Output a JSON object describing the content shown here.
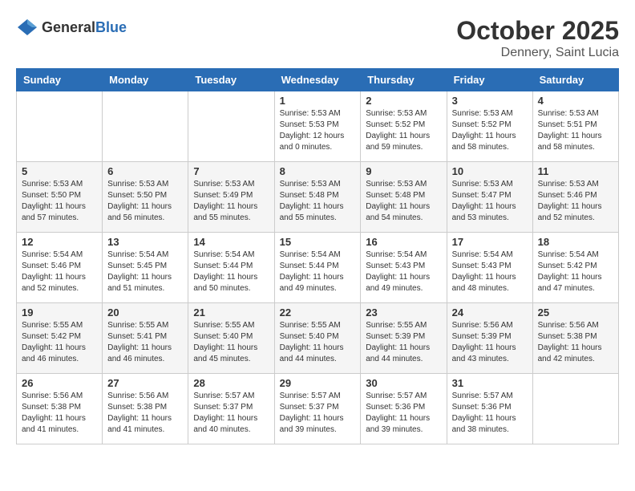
{
  "header": {
    "logo_general": "General",
    "logo_blue": "Blue",
    "month": "October 2025",
    "location": "Dennery, Saint Lucia"
  },
  "weekdays": [
    "Sunday",
    "Monday",
    "Tuesday",
    "Wednesday",
    "Thursday",
    "Friday",
    "Saturday"
  ],
  "weeks": [
    [
      {
        "day": "",
        "info": ""
      },
      {
        "day": "",
        "info": ""
      },
      {
        "day": "",
        "info": ""
      },
      {
        "day": "1",
        "info": "Sunrise: 5:53 AM\nSunset: 5:53 PM\nDaylight: 12 hours\nand 0 minutes."
      },
      {
        "day": "2",
        "info": "Sunrise: 5:53 AM\nSunset: 5:52 PM\nDaylight: 11 hours\nand 59 minutes."
      },
      {
        "day": "3",
        "info": "Sunrise: 5:53 AM\nSunset: 5:52 PM\nDaylight: 11 hours\nand 58 minutes."
      },
      {
        "day": "4",
        "info": "Sunrise: 5:53 AM\nSunset: 5:51 PM\nDaylight: 11 hours\nand 58 minutes."
      }
    ],
    [
      {
        "day": "5",
        "info": "Sunrise: 5:53 AM\nSunset: 5:50 PM\nDaylight: 11 hours\nand 57 minutes."
      },
      {
        "day": "6",
        "info": "Sunrise: 5:53 AM\nSunset: 5:50 PM\nDaylight: 11 hours\nand 56 minutes."
      },
      {
        "day": "7",
        "info": "Sunrise: 5:53 AM\nSunset: 5:49 PM\nDaylight: 11 hours\nand 55 minutes."
      },
      {
        "day": "8",
        "info": "Sunrise: 5:53 AM\nSunset: 5:48 PM\nDaylight: 11 hours\nand 55 minutes."
      },
      {
        "day": "9",
        "info": "Sunrise: 5:53 AM\nSunset: 5:48 PM\nDaylight: 11 hours\nand 54 minutes."
      },
      {
        "day": "10",
        "info": "Sunrise: 5:53 AM\nSunset: 5:47 PM\nDaylight: 11 hours\nand 53 minutes."
      },
      {
        "day": "11",
        "info": "Sunrise: 5:53 AM\nSunset: 5:46 PM\nDaylight: 11 hours\nand 52 minutes."
      }
    ],
    [
      {
        "day": "12",
        "info": "Sunrise: 5:54 AM\nSunset: 5:46 PM\nDaylight: 11 hours\nand 52 minutes."
      },
      {
        "day": "13",
        "info": "Sunrise: 5:54 AM\nSunset: 5:45 PM\nDaylight: 11 hours\nand 51 minutes."
      },
      {
        "day": "14",
        "info": "Sunrise: 5:54 AM\nSunset: 5:44 PM\nDaylight: 11 hours\nand 50 minutes."
      },
      {
        "day": "15",
        "info": "Sunrise: 5:54 AM\nSunset: 5:44 PM\nDaylight: 11 hours\nand 49 minutes."
      },
      {
        "day": "16",
        "info": "Sunrise: 5:54 AM\nSunset: 5:43 PM\nDaylight: 11 hours\nand 49 minutes."
      },
      {
        "day": "17",
        "info": "Sunrise: 5:54 AM\nSunset: 5:43 PM\nDaylight: 11 hours\nand 48 minutes."
      },
      {
        "day": "18",
        "info": "Sunrise: 5:54 AM\nSunset: 5:42 PM\nDaylight: 11 hours\nand 47 minutes."
      }
    ],
    [
      {
        "day": "19",
        "info": "Sunrise: 5:55 AM\nSunset: 5:42 PM\nDaylight: 11 hours\nand 46 minutes."
      },
      {
        "day": "20",
        "info": "Sunrise: 5:55 AM\nSunset: 5:41 PM\nDaylight: 11 hours\nand 46 minutes."
      },
      {
        "day": "21",
        "info": "Sunrise: 5:55 AM\nSunset: 5:40 PM\nDaylight: 11 hours\nand 45 minutes."
      },
      {
        "day": "22",
        "info": "Sunrise: 5:55 AM\nSunset: 5:40 PM\nDaylight: 11 hours\nand 44 minutes."
      },
      {
        "day": "23",
        "info": "Sunrise: 5:55 AM\nSunset: 5:39 PM\nDaylight: 11 hours\nand 44 minutes."
      },
      {
        "day": "24",
        "info": "Sunrise: 5:56 AM\nSunset: 5:39 PM\nDaylight: 11 hours\nand 43 minutes."
      },
      {
        "day": "25",
        "info": "Sunrise: 5:56 AM\nSunset: 5:38 PM\nDaylight: 11 hours\nand 42 minutes."
      }
    ],
    [
      {
        "day": "26",
        "info": "Sunrise: 5:56 AM\nSunset: 5:38 PM\nDaylight: 11 hours\nand 41 minutes."
      },
      {
        "day": "27",
        "info": "Sunrise: 5:56 AM\nSunset: 5:38 PM\nDaylight: 11 hours\nand 41 minutes."
      },
      {
        "day": "28",
        "info": "Sunrise: 5:57 AM\nSunset: 5:37 PM\nDaylight: 11 hours\nand 40 minutes."
      },
      {
        "day": "29",
        "info": "Sunrise: 5:57 AM\nSunset: 5:37 PM\nDaylight: 11 hours\nand 39 minutes."
      },
      {
        "day": "30",
        "info": "Sunrise: 5:57 AM\nSunset: 5:36 PM\nDaylight: 11 hours\nand 39 minutes."
      },
      {
        "day": "31",
        "info": "Sunrise: 5:57 AM\nSunset: 5:36 PM\nDaylight: 11 hours\nand 38 minutes."
      },
      {
        "day": "",
        "info": ""
      }
    ]
  ]
}
